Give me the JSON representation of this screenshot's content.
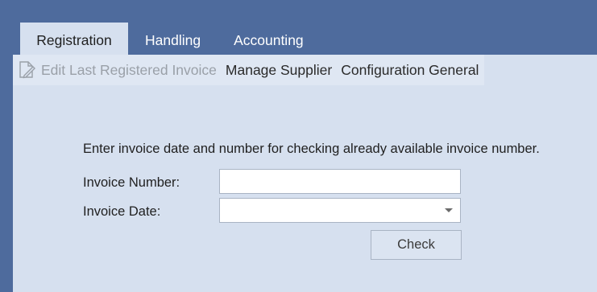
{
  "tabs": [
    {
      "label": "Registration",
      "active": true
    },
    {
      "label": "Handling",
      "active": false
    },
    {
      "label": "Accounting",
      "active": false
    }
  ],
  "ribbon": {
    "edit_last_label": "Edit Last Registered Invoice",
    "edit_last_icon": "edit-document-icon",
    "manage_supplier_label": "Manage Supplier",
    "configuration_label": "Configuration General"
  },
  "form": {
    "instructions": "Enter invoice date and number for checking already available invoice number.",
    "invoice_number_label": "Invoice Number:",
    "invoice_number_value": "",
    "invoice_date_label": "Invoice Date:",
    "invoice_date_value": "",
    "check_label": "Check"
  },
  "colors": {
    "window_background": "#4e6b9d",
    "panel_background": "#d6e0ef",
    "disabled_text": "#9aa0a8"
  }
}
